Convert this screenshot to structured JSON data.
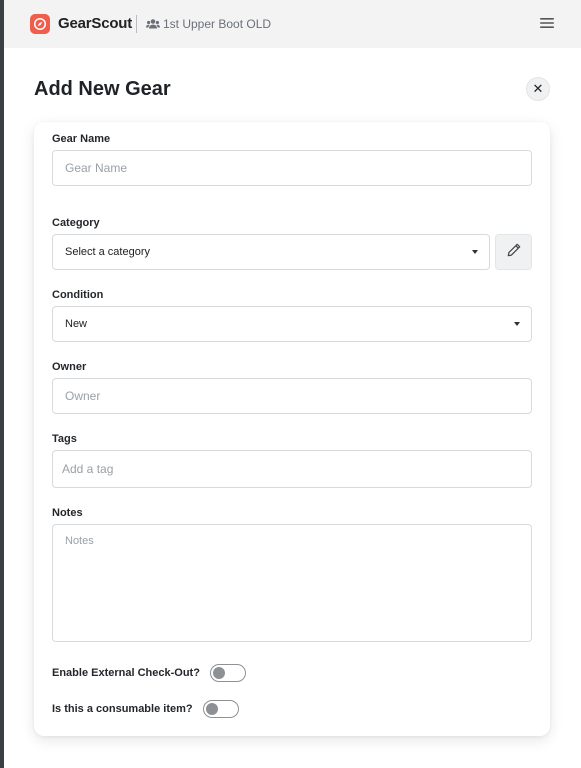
{
  "header": {
    "brand": "GearScout",
    "team_name": "1st Upper Boot OLD",
    "logo_icon": "compass-icon",
    "menu_icon": "hamburger-menu-icon",
    "accent_color": "#ef5e4c"
  },
  "page": {
    "title": "Add New Gear",
    "close_icon": "close-icon",
    "close_glyph": "✕"
  },
  "form": {
    "gear_name": {
      "label": "Gear Name",
      "placeholder": "Gear Name",
      "value": ""
    },
    "category": {
      "label": "Category",
      "selected": "Select a category",
      "edit_icon": "pencil-icon"
    },
    "condition": {
      "label": "Condition",
      "selected": "New"
    },
    "owner": {
      "label": "Owner",
      "placeholder": "Owner",
      "value": ""
    },
    "tags": {
      "label": "Tags",
      "placeholder": "Add a tag"
    },
    "notes": {
      "label": "Notes",
      "placeholder": "Notes"
    },
    "external_checkout": {
      "label": "Enable External Check-Out?",
      "enabled": false
    },
    "consumable": {
      "label": "Is this a consumable item?",
      "enabled": false
    }
  }
}
